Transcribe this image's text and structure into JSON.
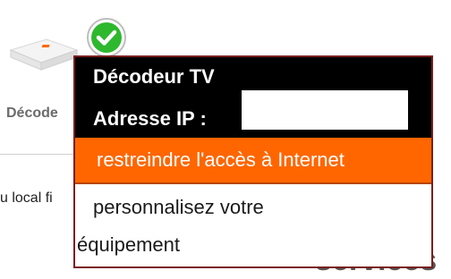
{
  "background": {
    "device_label": "Décode",
    "body_text": "u local fi",
    "heading": "services"
  },
  "device_icon": "tv-decoder-icon",
  "status_icon": "check-circle-icon",
  "popup": {
    "title": "Décodeur TV",
    "ip_label": "Adresse IP :",
    "ip_value": "",
    "restrict_button_label": "restreindre l'accès à Internet",
    "personalize_line1": "personnalisez votre",
    "personalize_line2": "équipement"
  },
  "colors": {
    "accent": "#ff6600",
    "popup_header": "#000000",
    "popup_border": "#7a1f1f",
    "status_green": "#2eb82e"
  }
}
